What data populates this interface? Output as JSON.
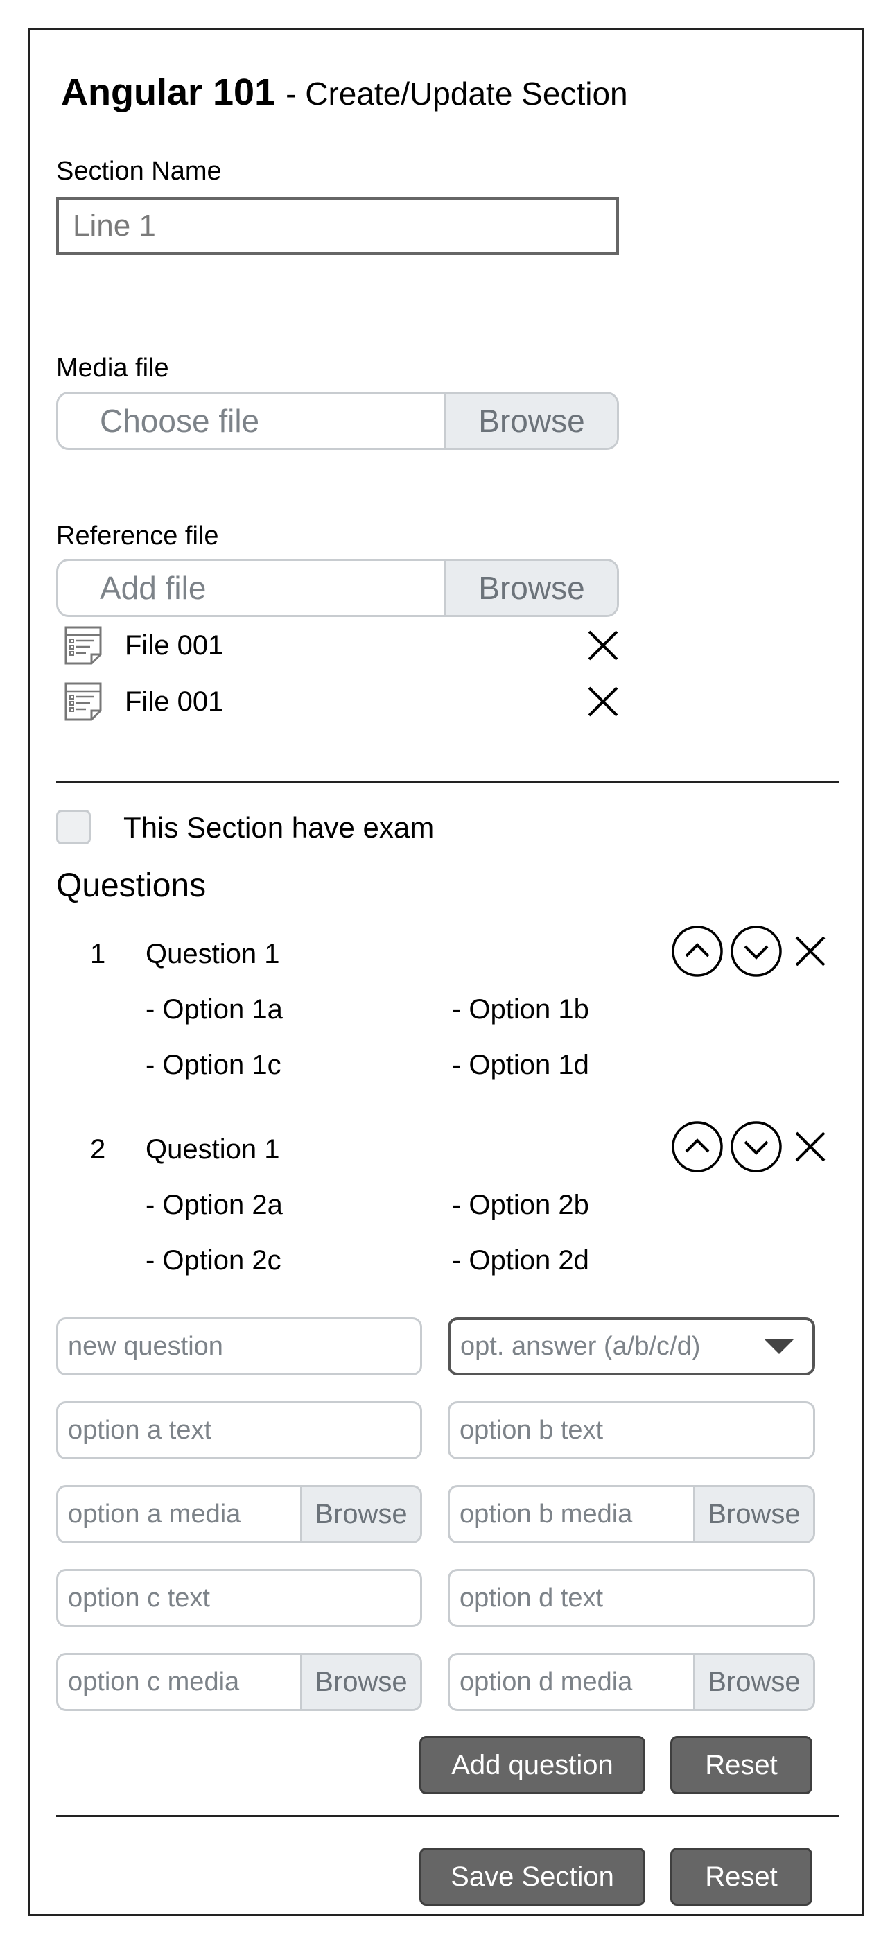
{
  "header": {
    "course": "Angular 101",
    "page_subtitle": "- Create/Update Section"
  },
  "section_name": {
    "label": "Section Name",
    "value": "Line 1"
  },
  "media_file": {
    "label": "Media file",
    "placeholder": "Choose file",
    "browse_label": "Browse"
  },
  "reference_file": {
    "label": "Reference file",
    "placeholder": "Add file",
    "browse_label": "Browse",
    "files": [
      {
        "name": "File 001"
      },
      {
        "name": "File 001"
      }
    ]
  },
  "exam": {
    "checkbox_label": "This Section have exam",
    "checked": false
  },
  "questions": {
    "heading": "Questions",
    "items": [
      {
        "number": "1",
        "text": "Question 1",
        "options": [
          "- Option 1a",
          "- Option 1b",
          "- Option 1c",
          "- Option 1d"
        ]
      },
      {
        "number": "2",
        "text": "Question 1",
        "options": [
          "- Option 2a",
          "- Option 2b",
          "- Option 2c",
          "- Option 2d"
        ]
      }
    ]
  },
  "question_form": {
    "new_question_placeholder": "new question",
    "answer_select_placeholder": "opt. answer (a/b/c/d)",
    "option_a_text": "option a text",
    "option_b_text": "option b text",
    "option_a_media": "option a media",
    "option_b_media": "option b media",
    "option_c_text": "option c text",
    "option_d_text": "option d text",
    "option_c_media": "option c media",
    "option_d_media": "option d media",
    "browse_label": "Browse",
    "add_question_label": "Add question",
    "reset_label": "Reset"
  },
  "footer": {
    "save_label": "Save Section",
    "reset_label": "Reset"
  },
  "colors": {
    "dark_button": "#666666",
    "border_light": "#c8ccd0",
    "addon_bg": "#e9ecef",
    "frame": "#222222"
  }
}
